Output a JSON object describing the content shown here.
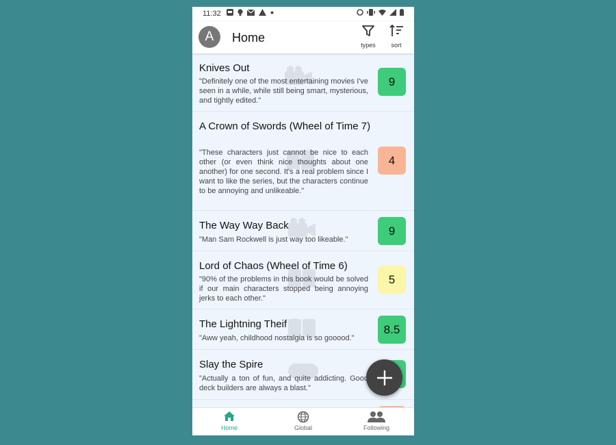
{
  "status_bar": {
    "time": "11:32"
  },
  "header": {
    "avatar_letter": "A",
    "title": "Home"
  },
  "actions": {
    "types": "types",
    "sort": "sort"
  },
  "colors": {
    "accent": "#1fa88a",
    "high": "#3ecb7a",
    "low": "#f8b596",
    "mid": "#fbf6a8"
  },
  "items": [
    {
      "title": "Knives Out",
      "review": "\"Definitely one of the most entertaining movies I've seen in a while, while still being smart, mysterious, and tightly edited.\"",
      "score": "9",
      "icon": "movie-icon"
    },
    {
      "title": "A Crown of Swords (Wheel of Time 7)",
      "review": "\"These characters just cannot be nice to each other (or even think nice thoughts about one another) for one second. It's a real problem since I want to like the series, but the characters continue to be annoying and unlikeable.\"",
      "score": "4",
      "icon": "book-icon"
    },
    {
      "title": "The Way Way Back",
      "review": "\"Man Sam Rockwell is just way too likeable.\"",
      "score": "9",
      "icon": "movie-icon"
    },
    {
      "title": "Lord of Chaos (Wheel of Time 6)",
      "review": "\"90% of the problems in this book would be solved if our main characters stopped being annoying jerks to each other.\"",
      "score": "5",
      "icon": "book-icon"
    },
    {
      "title": "The Lightning Theif",
      "review": "\"Aww yeah, childhood nostalgia is so gooood.\"",
      "score": "8.5",
      "icon": "book-icon"
    },
    {
      "title": "Slay the Spire",
      "review": "\"Actually a ton of fun, and quite addicting. Good deck builders are always a blast.\"",
      "score": "",
      "icon": "gamepad-icon"
    }
  ],
  "bottom_nav": {
    "home": "Home",
    "global": "Global",
    "following": "Following"
  }
}
